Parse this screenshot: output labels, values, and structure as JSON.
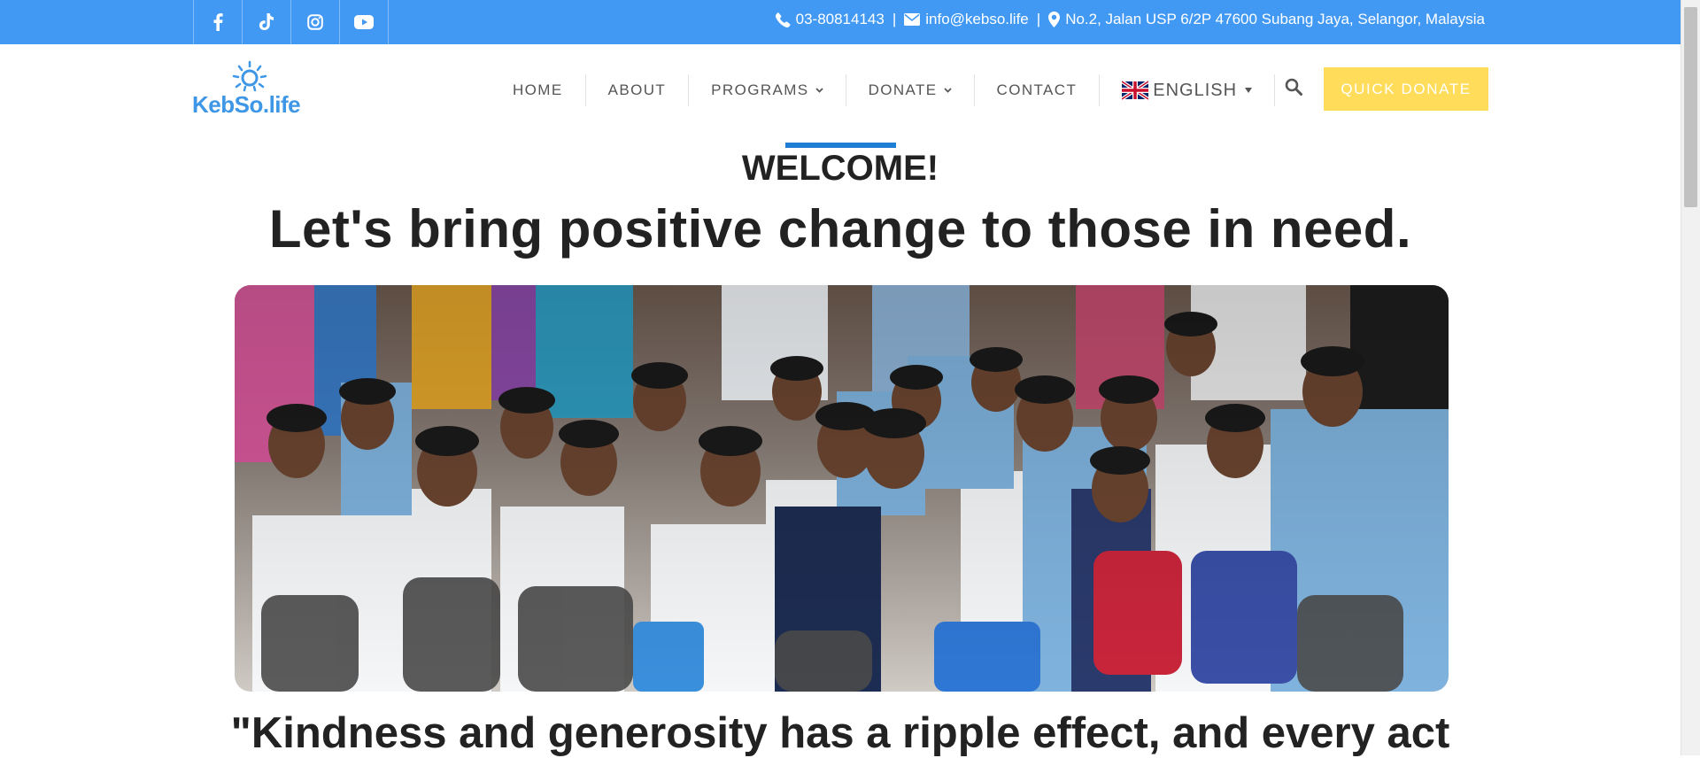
{
  "topbar": {
    "social_icons": [
      "facebook-icon",
      "tiktok-icon",
      "instagram-icon",
      "youtube-icon"
    ],
    "phone": "03-80814143",
    "email": "info@kebso.life",
    "address": "No.2, Jalan USP 6/2P 47600 Subang Jaya, Selangor, Malaysia",
    "separator": "|",
    "background_color": "#4299f4"
  },
  "header": {
    "logo_text": "KebSo.life",
    "nav": {
      "home": "HOME",
      "about": "ABOUT",
      "programs": "PROGRAMS",
      "donate": "DONATE",
      "contact": "CONTACT",
      "language": "ENGLISH"
    },
    "quick_donate": "QUICK DONATE",
    "accent_color": "#ffdc5a"
  },
  "hero": {
    "welcome": "WELCOME!",
    "headline": "Let's bring positive change to those in need.",
    "quote": "\"Kindness and generosity has a ripple effect, and every act",
    "accent_line_color": "#1e7dd4"
  }
}
